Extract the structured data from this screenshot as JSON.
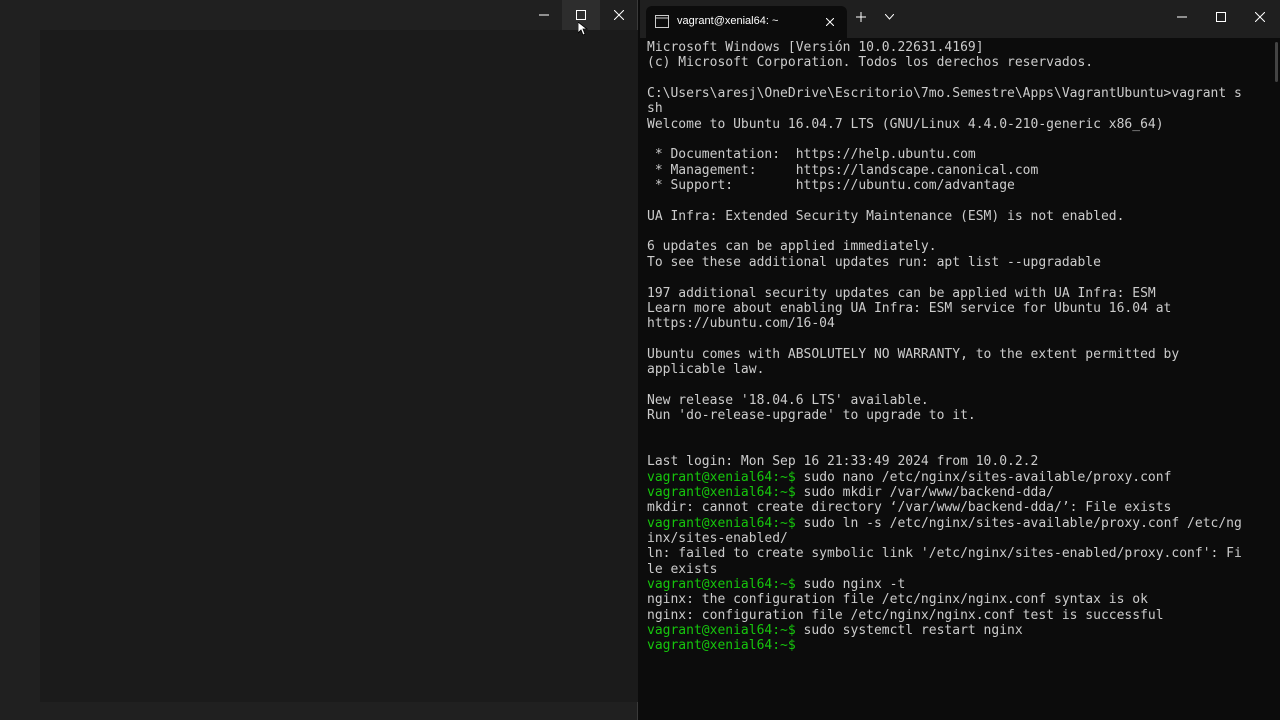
{
  "left_window": {
    "controls": {
      "minimize": "minimize",
      "maximize": "maximize",
      "close": "close"
    }
  },
  "terminal": {
    "tab_title": "vagrant@xenial64: ~",
    "prompt": "vagrant@xenial64:~$",
    "lines": [
      {
        "text": "Microsoft Windows [Versión 10.0.22631.4169]"
      },
      {
        "text": "(c) Microsoft Corporation. Todos los derechos reservados."
      },
      {
        "text": ""
      },
      {
        "text": "C:\\Users\\aresj\\OneDrive\\Escritorio\\7mo.Semestre\\Apps\\VagrantUbuntu>vagrant s"
      },
      {
        "text": "sh"
      },
      {
        "text": "Welcome to Ubuntu 16.04.7 LTS (GNU/Linux 4.4.0-210-generic x86_64)"
      },
      {
        "text": ""
      },
      {
        "text": " * Documentation:  https://help.ubuntu.com"
      },
      {
        "text": " * Management:     https://landscape.canonical.com"
      },
      {
        "text": " * Support:        https://ubuntu.com/advantage"
      },
      {
        "text": ""
      },
      {
        "text": "UA Infra: Extended Security Maintenance (ESM) is not enabled."
      },
      {
        "text": ""
      },
      {
        "text": "6 updates can be applied immediately."
      },
      {
        "text": "To see these additional updates run: apt list --upgradable"
      },
      {
        "text": ""
      },
      {
        "text": "197 additional security updates can be applied with UA Infra: ESM"
      },
      {
        "text": "Learn more about enabling UA Infra: ESM service for Ubuntu 16.04 at"
      },
      {
        "text": "https://ubuntu.com/16-04"
      },
      {
        "text": ""
      },
      {
        "text": "Ubuntu comes with ABSOLUTELY NO WARRANTY, to the extent permitted by"
      },
      {
        "text": "applicable law."
      },
      {
        "text": ""
      },
      {
        "text": "New release '18.04.6 LTS' available."
      },
      {
        "text": "Run 'do-release-upgrade' to upgrade to it."
      },
      {
        "text": ""
      },
      {
        "text": ""
      },
      {
        "text": "Last login: Mon Sep 16 21:33:49 2024 from 10.0.2.2"
      },
      {
        "prompt": true,
        "text": " sudo nano /etc/nginx/sites-available/proxy.conf"
      },
      {
        "prompt": true,
        "text": " sudo mkdir /var/www/backend-dda/"
      },
      {
        "text": "mkdir: cannot create directory ‘/var/www/backend-dda/’: File exists"
      },
      {
        "prompt": true,
        "text": " sudo ln -s /etc/nginx/sites-available/proxy.conf /etc/ng"
      },
      {
        "text": "inx/sites-enabled/"
      },
      {
        "text": "ln: failed to create symbolic link '/etc/nginx/sites-enabled/proxy.conf': Fi"
      },
      {
        "text": "le exists"
      },
      {
        "prompt": true,
        "text": " sudo nginx -t"
      },
      {
        "text": "nginx: the configuration file /etc/nginx/nginx.conf syntax is ok"
      },
      {
        "text": "nginx: configuration file /etc/nginx/nginx.conf test is successful"
      },
      {
        "prompt": true,
        "text": " sudo systemctl restart nginx"
      },
      {
        "prompt": true,
        "text": ""
      }
    ]
  },
  "colors": {
    "prompt": "#16c60c",
    "text": "#cccccc",
    "background": "#0c0c0c"
  },
  "icons": [
    "minimize-icon",
    "maximize-icon",
    "close-icon",
    "terminal-icon",
    "plus-icon",
    "chevron-down-icon",
    "mouse-cursor-icon"
  ]
}
